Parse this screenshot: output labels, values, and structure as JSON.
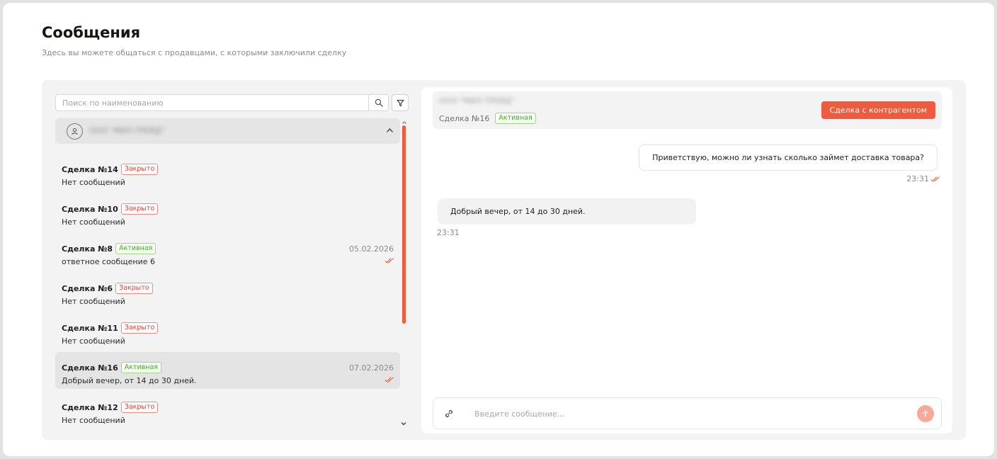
{
  "page": {
    "title": "Сообщения",
    "subtitle": "Здесь вы можете общаться с продавцами, с которыми заключили сделку"
  },
  "search": {
    "placeholder": "Поиск по наименованию",
    "value": ""
  },
  "group": {
    "name": "ООО \"МИЛ-ТРЕЙД\"",
    "expanded": true
  },
  "deals": [
    {
      "name": "Сделка №14",
      "status": "Закрыто",
      "status_type": "closed",
      "message": "Нет сообщений",
      "date": "",
      "read": false,
      "selected": false
    },
    {
      "name": "Сделка №10",
      "status": "Закрыто",
      "status_type": "closed",
      "message": "Нет сообщений",
      "date": "",
      "read": false,
      "selected": false
    },
    {
      "name": "Сделка №8",
      "status": "Активная",
      "status_type": "active",
      "message": "ответное сообщение 6",
      "date": "05.02.2026",
      "read": true,
      "selected": false
    },
    {
      "name": "Сделка №6",
      "status": "Закрыто",
      "status_type": "closed",
      "message": "Нет сообщений",
      "date": "",
      "read": false,
      "selected": false
    },
    {
      "name": "Сделка №11",
      "status": "Закрыто",
      "status_type": "closed",
      "message": "Нет сообщений",
      "date": "",
      "read": false,
      "selected": false
    },
    {
      "name": "Сделка №16",
      "status": "Активная",
      "status_type": "active",
      "message": "Добрый вечер, от 14 до 30 дней.",
      "date": "07.02.2026",
      "read": true,
      "selected": true
    },
    {
      "name": "Сделка №12",
      "status": "Закрыто",
      "status_type": "closed",
      "message": "Нет сообщений",
      "date": "",
      "read": false,
      "selected": false
    }
  ],
  "chat": {
    "counterparty": "ООО \"МИЛ-ТРЕЙД\"",
    "deal_name": "Сделка №16",
    "deal_status": "Активная",
    "cta_label": "Сделка с контрагентом",
    "messages": [
      {
        "direction": "out",
        "text": "Приветствую, можно ли узнать сколько займет доставка товара?",
        "time": "23:31",
        "read": true
      },
      {
        "direction": "in",
        "text": "Добрый вечер, от 14 до 30 дней.",
        "time": "23:31"
      }
    ],
    "composer_placeholder": "Введите сообщение..."
  },
  "colors": {
    "accent": "#ef5b3e",
    "closed": "#e0453a",
    "active": "#4aa832",
    "send_disabled": "#f6a999"
  },
  "icons": {
    "search": "search-icon",
    "filter": "filter-icon",
    "avatar": "user-icon",
    "collapse": "chevron-up-icon",
    "scroll_down": "chevron-down-icon",
    "read": "double-check-icon",
    "attach": "link-icon",
    "send": "arrow-up-icon"
  }
}
